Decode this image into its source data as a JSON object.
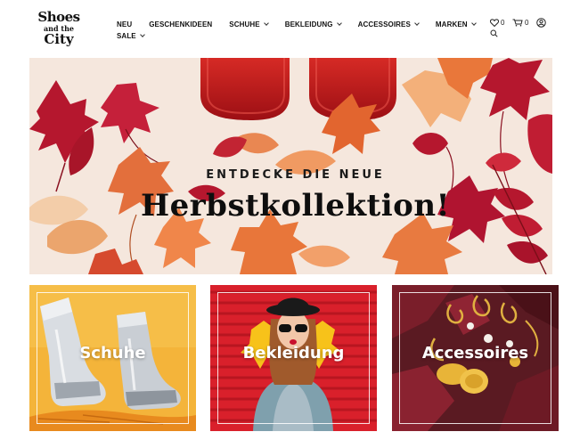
{
  "logo": {
    "line1": "Shoes",
    "line2": "and the",
    "line3": "City"
  },
  "nav": {
    "row1": [
      {
        "label": "NEU",
        "has_dropdown": false
      },
      {
        "label": "GESCHENKIDEEN",
        "has_dropdown": false
      },
      {
        "label": "SCHUHE",
        "has_dropdown": true
      },
      {
        "label": "BEKLEIDUNG",
        "has_dropdown": true
      },
      {
        "label": "ACCESSOIRES",
        "has_dropdown": true
      },
      {
        "label": "MARKEN",
        "has_dropdown": true
      }
    ],
    "row2": [
      {
        "label": "SALE",
        "has_dropdown": true
      }
    ]
  },
  "header_icons": {
    "wishlist": {
      "icon": "heart-icon",
      "count": "0"
    },
    "cart": {
      "icon": "cart-icon",
      "count": "0"
    },
    "account": {
      "icon": "user-icon"
    },
    "search": {
      "icon": "search-icon"
    }
  },
  "hero": {
    "subtitle": "ENTDECKE DIE NEUE",
    "title": "Herbstkollektion!"
  },
  "categories": [
    {
      "label": "Schuhe",
      "bg": "#f4b43a"
    },
    {
      "label": "Bekleidung",
      "bg": "#d9202b"
    },
    {
      "label": "Accessoires",
      "bg": "#5a1a22"
    }
  ],
  "colors": {
    "text": "#111111",
    "hero_bg": "#f4e6dc",
    "leaf_red": "#b5172e",
    "leaf_orange": "#e9773a",
    "leaf_peach": "#f2b98e",
    "boot_red": "#c81c22"
  }
}
